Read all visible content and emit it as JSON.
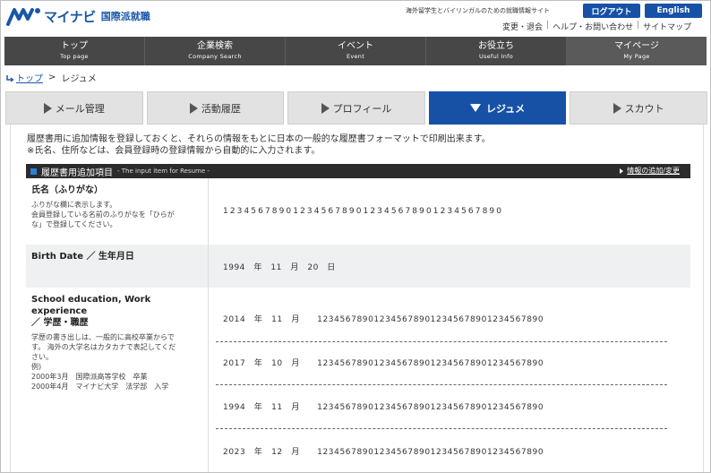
{
  "header": {
    "logo_text": "マイナビ",
    "logo_sub": "国際派就職",
    "tagline": "海外留学生とバイリンガルのための就職情報サイト",
    "logout_label": "ログアウト",
    "english_label": "English",
    "sublinks": [
      "変更・退会",
      "ヘルプ・お問い合わせ",
      "サイトマップ"
    ]
  },
  "gnav": [
    {
      "jp": "トップ",
      "en": "Top page"
    },
    {
      "jp": "企業検索",
      "en": "Company Search"
    },
    {
      "jp": "イベント",
      "en": "Event"
    },
    {
      "jp": "お役立ち",
      "en": "Useful Info"
    },
    {
      "jp": "マイページ",
      "en": "My Page"
    }
  ],
  "breadcrumb": {
    "home": "トップ",
    "sep": ">",
    "current": "レジュメ"
  },
  "tabs": [
    {
      "label": "メール管理"
    },
    {
      "label": "活動履歴"
    },
    {
      "label": "プロフィール"
    },
    {
      "label": "レジュメ"
    },
    {
      "label": "スカウト"
    }
  ],
  "intro": {
    "line1": "履歴書用に追加情報を登録しておくと、それらの情報をもとに日本の一般的な履歴書フォーマットで印刷出来ます。",
    "line2": "※氏名、住所などは、会員登録時の登録情報から自動的に入力されます。"
  },
  "section": {
    "title": "履歴書用追加項目",
    "subtitle": "- The input item for Resume -",
    "link": "情報の追加/変更"
  },
  "fields": {
    "name": {
      "title": "氏名（ふりがな）",
      "desc": [
        "ふりがな欄に表示します。",
        "会員登録している名前のふりがなを「ひらが",
        "な」で登録してください。"
      ],
      "value": "1234567890123456789012345678901234567890"
    },
    "birth": {
      "title": "Birth Date ／ 生年月日",
      "value": "1994　年　11　月　20　日"
    },
    "education": {
      "title_line1": "School education, Work experience",
      "title_line2": "／ 学歴・職歴",
      "desc": [
        "学歴の書き出しは、一般的に高校卒業からで",
        "す。 海外の大学名はカタカナで表記してくだ",
        "さい。",
        "例)",
        "2000年3月　国際派高等学校　卒業",
        "2000年4月　マイナビ大学　法学部　入学"
      ],
      "entries": [
        "2014　年　11　月　　1234567890123456789012345678901234567890",
        "2017　年　10　月　　1234567890123456789012345678901234567890",
        "1994　年　11　月　　1234567890123456789012345678901234567890",
        "2023　年　12　月　　1234567890123456789012345678901234567890"
      ]
    }
  },
  "colors": {
    "brand": "#1751a6",
    "nav_bg": "#474747",
    "section_bar": "#2b2b2b"
  }
}
